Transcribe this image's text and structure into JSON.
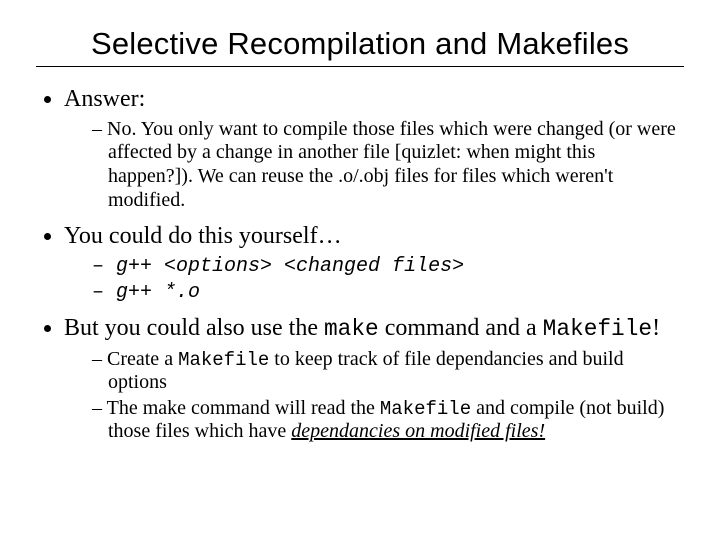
{
  "title": "Selective Recompilation and Makefiles",
  "bullets": {
    "b1": {
      "label": "Answer:",
      "sub1": "No.  You only want to compile those files which were changed (or were affected by a change in another file [quizlet: when might this happen?]).  We can reuse the .o/.obj files for files which weren't modified."
    },
    "b2": {
      "label": "You could do this yourself…",
      "code1": "g++ <options> <changed files>",
      "code2": "g++ *.o"
    },
    "b3": {
      "pre": "But you could also use the ",
      "make": "make",
      "mid": " command and a ",
      "mf": "Makefile",
      "post": "!",
      "sub1_pre": "Create a ",
      "sub1_mf": "Makefile",
      "sub1_post": " to keep track of file dependancies and build options",
      "sub2_pre": "The make command will read the ",
      "sub2_mf": "Makefile",
      "sub2_mid": " and compile (not build) those files which have ",
      "sub2_emph": "dependancies on modified files!"
    }
  }
}
